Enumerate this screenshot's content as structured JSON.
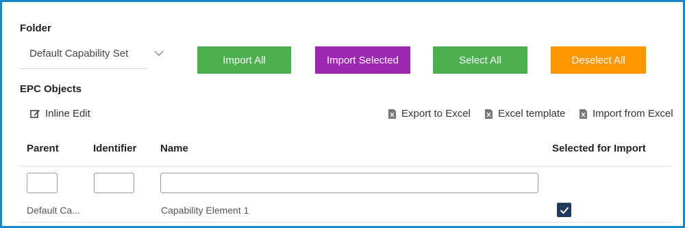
{
  "folder": {
    "title": "Folder",
    "selected_value": "Default Capability Set"
  },
  "buttons": {
    "import_all": "Import All",
    "import_selected": "Import Selected",
    "select_all": "Select All",
    "deselect_all": "Deselect All"
  },
  "colors": {
    "frame_border": "#1b87c9",
    "import_all": "#4caf50",
    "import_selected": "#9c27b0",
    "select_all": "#4caf50",
    "deselect_all": "#ff9800",
    "checkbox": "#1f3a5c"
  },
  "epc": {
    "title": "EPC Objects",
    "inline_edit": "Inline Edit",
    "export_excel": "Export to Excel",
    "excel_template": "Excel template",
    "import_excel": "Import from Excel"
  },
  "table": {
    "columns": [
      "Parent",
      "Identifier",
      "Name",
      "Selected for Import"
    ],
    "rows": [
      {
        "parent": "Default Ca...",
        "identifier": "",
        "name": "Capability Element 1",
        "selected": true
      }
    ]
  },
  "icons": [
    "chevron-down-icon",
    "edit-icon",
    "excel-icon",
    "check-icon"
  ]
}
